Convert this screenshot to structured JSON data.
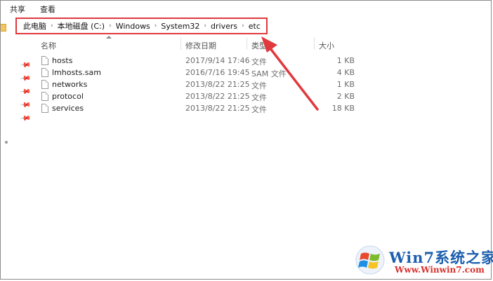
{
  "ribbon": {
    "tabs": [
      "共享",
      "查看"
    ]
  },
  "address_bar": {
    "crumbs": [
      "此电脑",
      "本地磁盘 (C:)",
      "Windows",
      "System32",
      "drivers",
      "etc"
    ],
    "separator": "›"
  },
  "columns": {
    "name": "名称",
    "modified": "修改日期",
    "type": "类型",
    "size": "大小"
  },
  "files": [
    {
      "name": "hosts",
      "modified": "2017/9/14 17:46",
      "type": "文件",
      "size": "1 KB"
    },
    {
      "name": "lmhosts.sam",
      "modified": "2016/7/16 19:45",
      "type": "SAM 文件",
      "size": "4 KB"
    },
    {
      "name": "networks",
      "modified": "2013/8/22 21:25",
      "type": "文件",
      "size": "1 KB"
    },
    {
      "name": "protocol",
      "modified": "2013/8/22 21:25",
      "type": "文件",
      "size": "2 KB"
    },
    {
      "name": "services",
      "modified": "2013/8/22 21:25",
      "type": "文件",
      "size": "18 KB"
    }
  ],
  "quick_access": {
    "pin_glyph": "📌",
    "pin_count": 5
  },
  "annotation": {
    "color": "#e0393e"
  },
  "watermark": {
    "title": "Win7系统之家",
    "url": "Www.Winwin7.com"
  },
  "colors": {
    "highlight_border": "#e0393e",
    "folder": "#f3c55b",
    "watermark_blue": "#1c5fae",
    "watermark_red": "#d9322e"
  }
}
